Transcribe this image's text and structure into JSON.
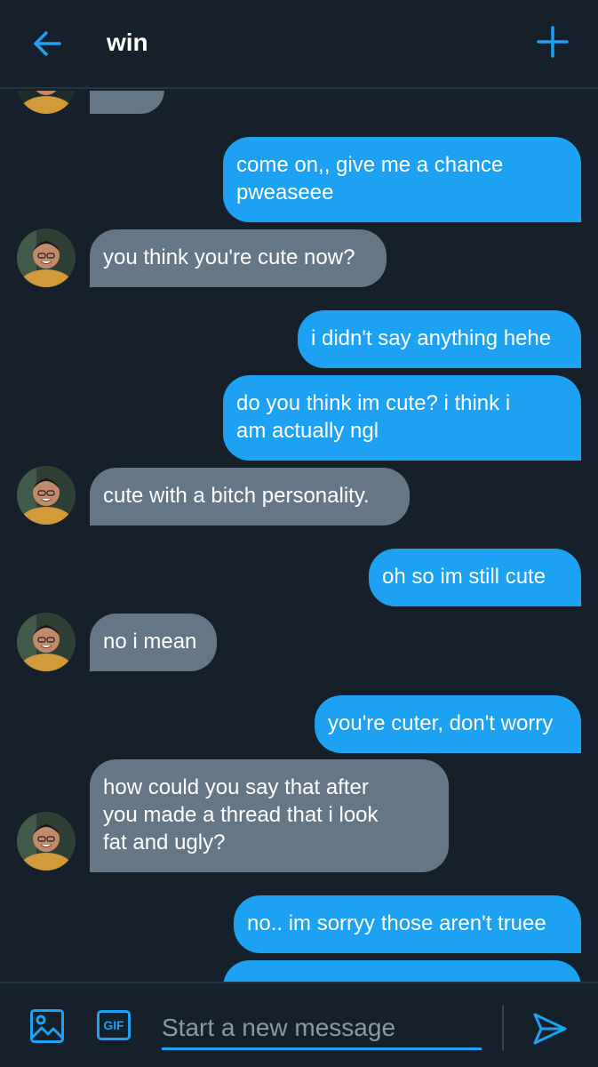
{
  "header": {
    "title": "win"
  },
  "messages": [
    {
      "side": "received",
      "text": ""
    },
    {
      "side": "sent",
      "lines": [
        "come on,, give me a chance",
        "pweaseee"
      ]
    },
    {
      "side": "received",
      "text": "you think you're cute now?"
    },
    {
      "side": "sent",
      "text": "i didn't say anything hehe"
    },
    {
      "side": "sent",
      "lines": [
        "do you think im cute? i think i",
        "am actually ngl"
      ]
    },
    {
      "side": "received",
      "text": "cute with a bitch personality."
    },
    {
      "side": "sent",
      "text": "oh so im still cute"
    },
    {
      "side": "received",
      "text": "no i mean"
    },
    {
      "side": "sent",
      "text": "you're cuter, don't worry"
    },
    {
      "side": "received",
      "lines": [
        "how could you say that after",
        "you made a thread that i look",
        "fat and ugly?"
      ]
    },
    {
      "side": "sent",
      "text": "no.. im sorryy those aren't truee"
    },
    {
      "side": "sent",
      "text": ""
    }
  ],
  "composer": {
    "placeholder": "Start a new message",
    "gif_label": "GIF"
  },
  "colors": {
    "background": "#15202b",
    "accent": "#1da1f2",
    "received_bubble": "#657786",
    "divider": "#253341"
  },
  "icons": {
    "back": "arrow-left-icon",
    "new": "plus-icon",
    "media": "image-icon",
    "gif": "gif-icon",
    "send": "send-icon"
  }
}
